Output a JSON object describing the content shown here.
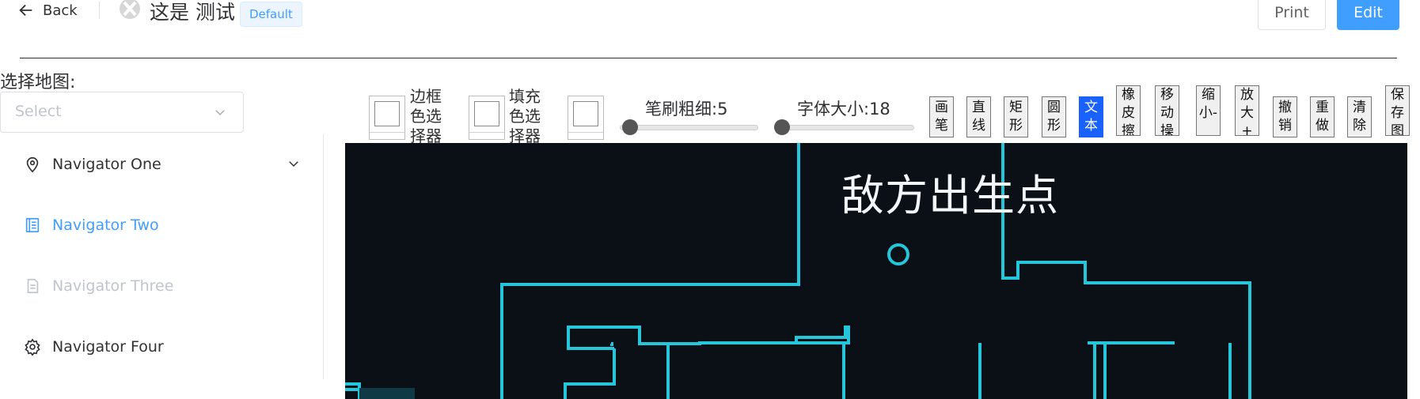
{
  "header": {
    "back_label": "Back",
    "title": "这是 测试",
    "tag": "Default",
    "print_label": "Print",
    "edit_label": "Edit"
  },
  "sidebar": {
    "map_label": "选择地图:",
    "select_placeholder": "Select",
    "items": [
      {
        "label": "Navigator One",
        "icon": "location-icon",
        "state": "normal"
      },
      {
        "label": "Navigator Two",
        "icon": "document-icon",
        "state": "active"
      },
      {
        "label": "Navigator Three",
        "icon": "file-icon",
        "state": "disabled"
      },
      {
        "label": "Navigator Four",
        "icon": "gear-icon",
        "state": "normal"
      }
    ]
  },
  "toolbar": {
    "border_color_label": "边框色选择器",
    "fill_color_label": "填充色选择器",
    "brush_label": "笔刷粗细:5",
    "font_label": "字体大小:18",
    "tools": [
      "画笔",
      "直线",
      "矩形",
      "圆形",
      "文本",
      "橡皮擦",
      "移动操作",
      "缩小-",
      "放大+",
      "撤销",
      "重做",
      "清除",
      "保存图片"
    ],
    "active_tool": "文本"
  },
  "canvas": {
    "label": "敌方出生点",
    "line_color": "#25c6d9",
    "background": "#0a1016"
  },
  "colors": {
    "accent": "#409eff",
    "active_tool": "#1a62ff"
  }
}
